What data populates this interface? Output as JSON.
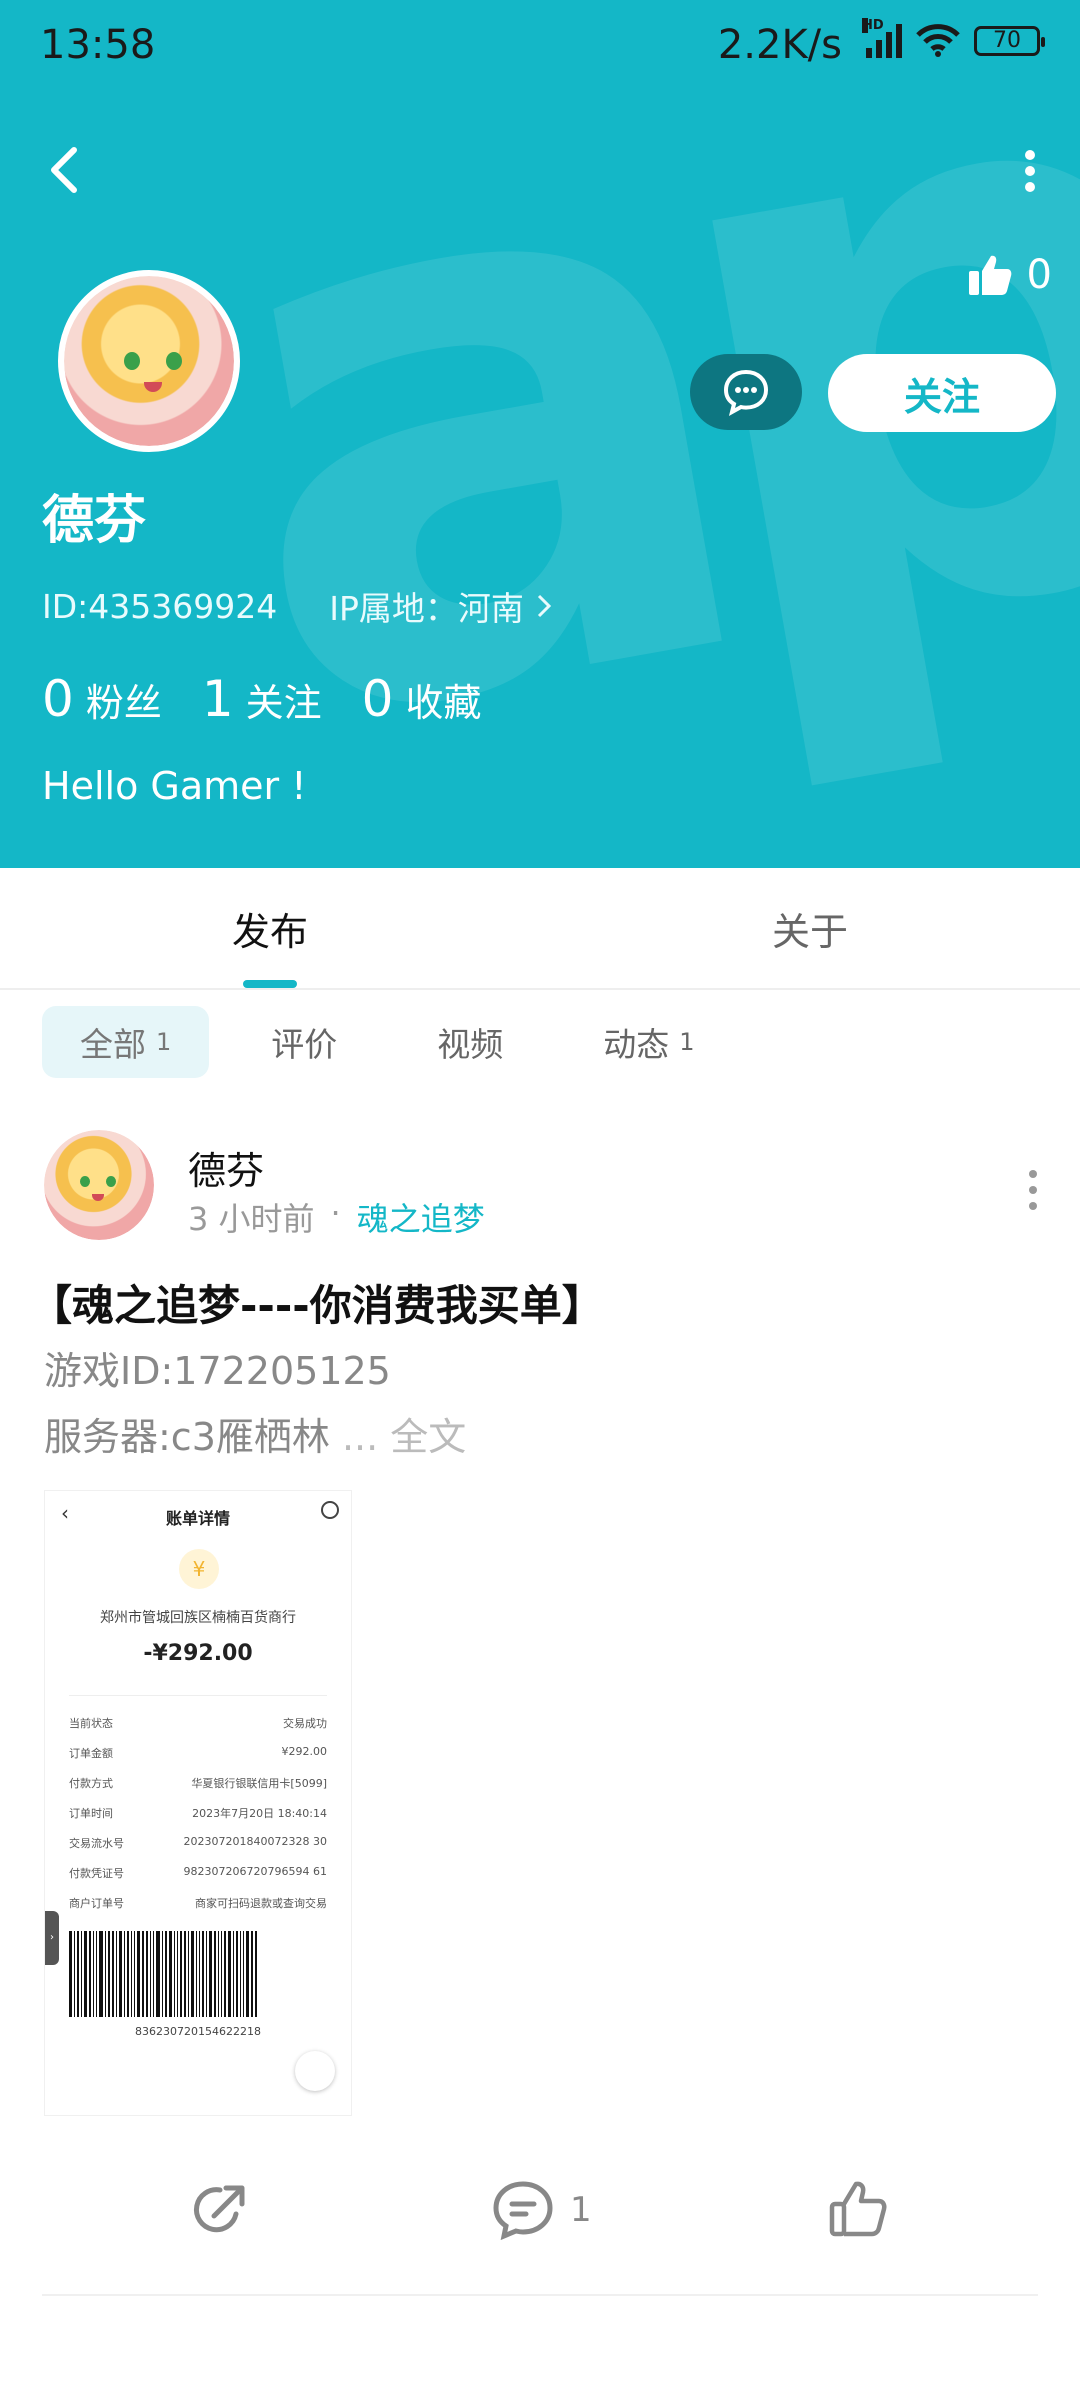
{
  "status_bar": {
    "time": "13:58",
    "network_speed": "2.2K/s",
    "hd": "HD",
    "battery": "70"
  },
  "profile": {
    "likes": "0",
    "follow_label": "关注",
    "name": "德芬",
    "id_text": "ID:435369924",
    "ip_text": "IP属地：河南",
    "stats": [
      {
        "count": "0",
        "label": "粉丝"
      },
      {
        "count": "1",
        "label": "关注"
      },
      {
        "count": "0",
        "label": "收藏"
      }
    ],
    "bio": "Hello Gamer !"
  },
  "main_tabs": [
    {
      "label": "发布",
      "active": true
    },
    {
      "label": "关于",
      "active": false
    }
  ],
  "filters": [
    {
      "label": "全部",
      "count": "1",
      "active": true
    },
    {
      "label": "评价",
      "count": "",
      "active": false
    },
    {
      "label": "视频",
      "count": "",
      "active": false
    },
    {
      "label": "动态",
      "count": "1",
      "active": false
    }
  ],
  "post": {
    "author": "德芬",
    "time": "3 小时前",
    "separator": "·",
    "group": "魂之追梦",
    "title": "【魂之追梦----你消费我买单】",
    "line1": "游戏ID:172205125",
    "line2": "服务器:c3雁栖林",
    "more": "... 全文",
    "comments": "1"
  },
  "receipt": {
    "title": "账单详情",
    "merchant": "郑州市管城回族区楠楠百货商行",
    "amount": "-¥292.00",
    "rows": [
      {
        "label": "当前状态",
        "value": "交易成功"
      },
      {
        "label": "订单金额",
        "value": "¥292.00"
      },
      {
        "label": "付款方式",
        "value": "华夏银行银联信用卡[5099]"
      },
      {
        "label": "订单时间",
        "value": "2023年7月20日 18:40:14"
      },
      {
        "label": "交易流水号",
        "value": "202307201840072328 30"
      },
      {
        "label": "付款凭证号",
        "value": "982307206720796594 61"
      },
      {
        "label": "商户订单号",
        "value": "商家可扫码退款或查询交易"
      }
    ],
    "barcode_number": "836230720154622218"
  },
  "colors": {
    "accent": "#14b7c7",
    "chat_button": "#0d7681"
  }
}
